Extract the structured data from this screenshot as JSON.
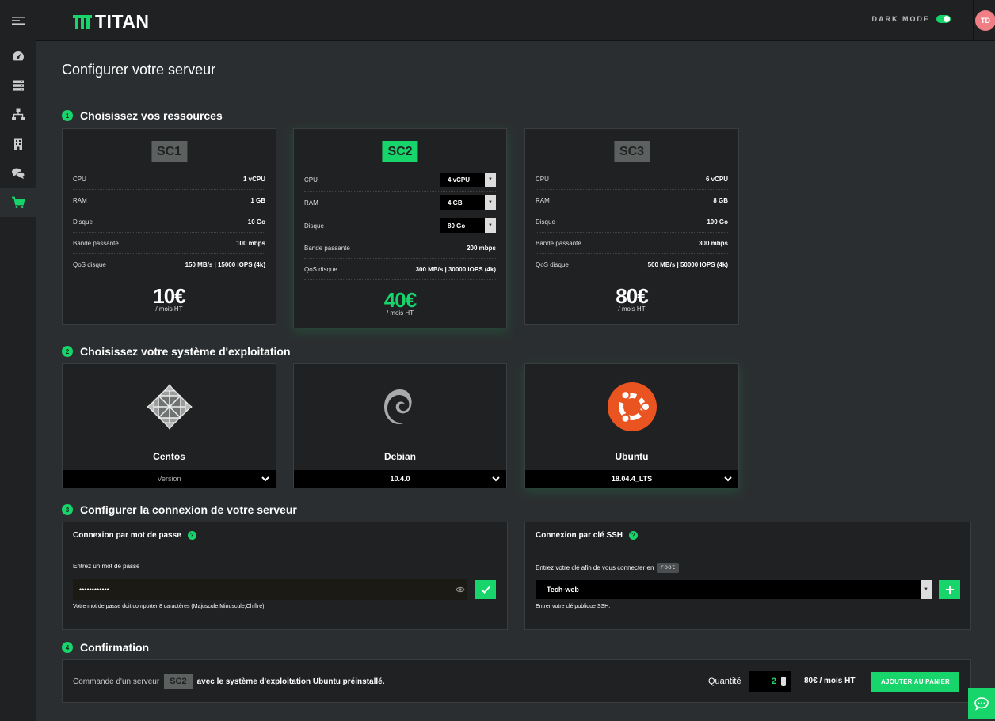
{
  "header": {
    "brand": "TITAN",
    "dark_mode_label": "DARK MODE",
    "avatar_initials": "TD"
  },
  "colors": {
    "accent": "#17d46b",
    "background": "#2b2e30",
    "panel": "#1f2122",
    "ubuntu": "#e95420",
    "avatar": "#ef7f85"
  },
  "sidebar": {
    "items": [
      {
        "icon": "menu-icon"
      },
      {
        "icon": "dashboard-icon"
      },
      {
        "icon": "servers-icon"
      },
      {
        "icon": "network-icon"
      },
      {
        "icon": "building-icon"
      },
      {
        "icon": "chat-icon"
      },
      {
        "icon": "cart-icon"
      }
    ]
  },
  "page": {
    "title": "Configurer votre serveur"
  },
  "steps": [
    {
      "num": "1",
      "label": "Choisissez vos ressources"
    },
    {
      "num": "2",
      "label": "Choisissez votre système d'exploitation"
    },
    {
      "num": "3",
      "label": "Configurer la connexion de votre serveur"
    },
    {
      "num": "4",
      "label": "Confirmation"
    }
  ],
  "plans": [
    {
      "name": "SC1",
      "specs": [
        {
          "key": "CPU",
          "value": "1 vCPU"
        },
        {
          "key": "RAM",
          "value": "1 GB"
        },
        {
          "key": "Disque",
          "value": "10 Go"
        },
        {
          "key": "Bande passante",
          "value": "100 mbps"
        },
        {
          "key": "QoS disque",
          "value": "150 MB/s | 15000 IOPS (4k)"
        }
      ],
      "price": "10€",
      "price_sub": "/ mois HT"
    },
    {
      "name": "SC2",
      "specs": [
        {
          "key": "CPU",
          "value": "4 vCPU"
        },
        {
          "key": "RAM",
          "value": "4 GB"
        },
        {
          "key": "Disque",
          "value": "80 Go"
        },
        {
          "key": "Bande passante",
          "value": "200 mbps"
        },
        {
          "key": "QoS disque",
          "value": "300 MB/s | 30000 IOPS (4k)"
        }
      ],
      "price": "40€",
      "price_sub": "/ mois HT"
    },
    {
      "name": "SC3",
      "specs": [
        {
          "key": "CPU",
          "value": "6 vCPU"
        },
        {
          "key": "RAM",
          "value": "8 GB"
        },
        {
          "key": "Disque",
          "value": "100 Go"
        },
        {
          "key": "Bande passante",
          "value": "300 mbps"
        },
        {
          "key": "QoS disque",
          "value": "500 MB/s | 50000 IOPS (4k)"
        }
      ],
      "price": "80€",
      "price_sub": "/ mois HT"
    }
  ],
  "os": [
    {
      "name": "Centos",
      "version_placeholder": "Version",
      "version": "",
      "icon": "centos-logo-icon"
    },
    {
      "name": "Debian",
      "version_placeholder": "",
      "version": "10.4.0",
      "icon": "debian-logo-icon"
    },
    {
      "name": "Ubuntu",
      "version_placeholder": "",
      "version": "18.04.4_LTS",
      "icon": "ubuntu-logo-icon"
    }
  ],
  "connection": {
    "password": {
      "title": "Connexion par mot de passe",
      "label": "Entrez un mot de passe",
      "value": "••••••••••••",
      "hint": "Votre mot de passe doit comporter 8 caractères (Majuscule,Minuscule,Chiffre)."
    },
    "ssh": {
      "title": "Connexion par clé SSH",
      "label": "Entrez votre clé afin de vous connecter en",
      "user_chip": "root",
      "selected_key": "Tech-web",
      "hint": "Entrer votre clé publique SSH."
    }
  },
  "confirmation": {
    "prefix": "Commande d'un serveur",
    "plan": "SC2",
    "suffix": "avec le système d'exploitation Ubuntu préinstallé.",
    "quantity_label": "Quantité",
    "quantity": "2",
    "total": "80€ / mois HT",
    "cart_button": "AJOUTER AU PANIER"
  }
}
